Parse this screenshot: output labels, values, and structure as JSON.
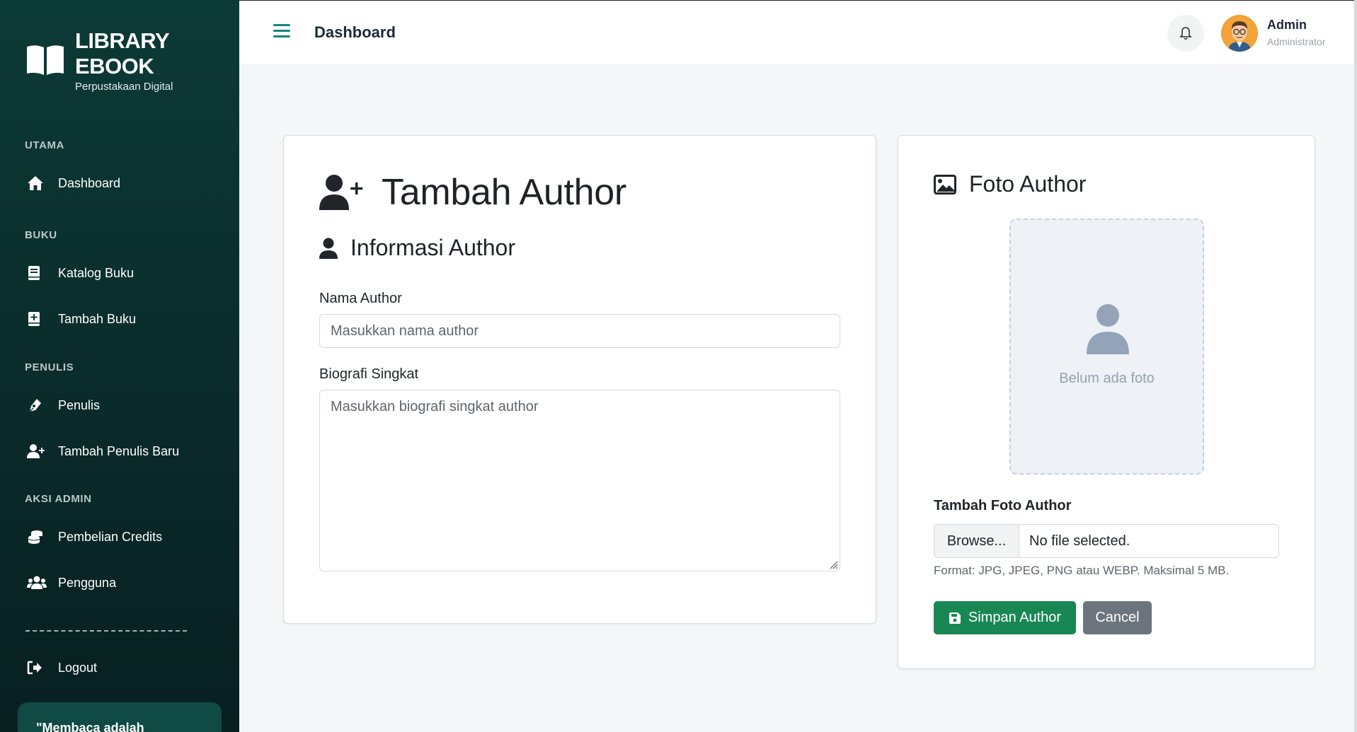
{
  "sidebar": {
    "brand": {
      "title_line1": "LIBRARY",
      "title_line2": "EBOOK",
      "subtitle": "Perpustakaan Digital"
    },
    "sections": [
      {
        "label": "UTAMA",
        "items": [
          {
            "label": "Dashboard",
            "icon": "home-icon"
          }
        ]
      },
      {
        "label": "BUKU",
        "items": [
          {
            "label": "Katalog Buku",
            "icon": "book-icon"
          },
          {
            "label": "Tambah Buku",
            "icon": "book-add-icon"
          }
        ]
      },
      {
        "label": "PENULIS",
        "items": [
          {
            "label": "Penulis",
            "icon": "pen-nib-icon"
          },
          {
            "label": "Tambah Penulis Baru",
            "icon": "user-plus-icon"
          }
        ]
      },
      {
        "label": "AKSI ADMIN",
        "items": [
          {
            "label": "Pembelian Credits",
            "icon": "coins-icon"
          },
          {
            "label": "Pengguna",
            "icon": "users-icon"
          }
        ]
      }
    ],
    "logout_label": "Logout",
    "quote_text": "\"Membaca adalah"
  },
  "topbar": {
    "title": "Dashboard",
    "user_name": "Admin",
    "user_role": "Administrator"
  },
  "form": {
    "heading": "Tambah Author",
    "section_heading": "Informasi Author",
    "name_label": "Nama Author",
    "name_placeholder": "Masukkan nama author",
    "bio_label": "Biografi Singkat",
    "bio_placeholder": "Masukkan biografi singkat author"
  },
  "photo": {
    "heading": "Foto Author",
    "empty_text": "Belum ada foto",
    "upload_label": "Tambah Foto Author",
    "browse_label": "Browse...",
    "file_status": "No file selected.",
    "hint": "Format: JPG, JPEG, PNG atau WEBP. Maksimal 5 MB."
  },
  "actions": {
    "save_label": "Simpan Author",
    "cancel_label": "Cancel"
  },
  "colors": {
    "sidebar_bg": "#0a2b2a",
    "accent": "#14857a",
    "save": "#198754",
    "cancel": "#6c757d"
  }
}
